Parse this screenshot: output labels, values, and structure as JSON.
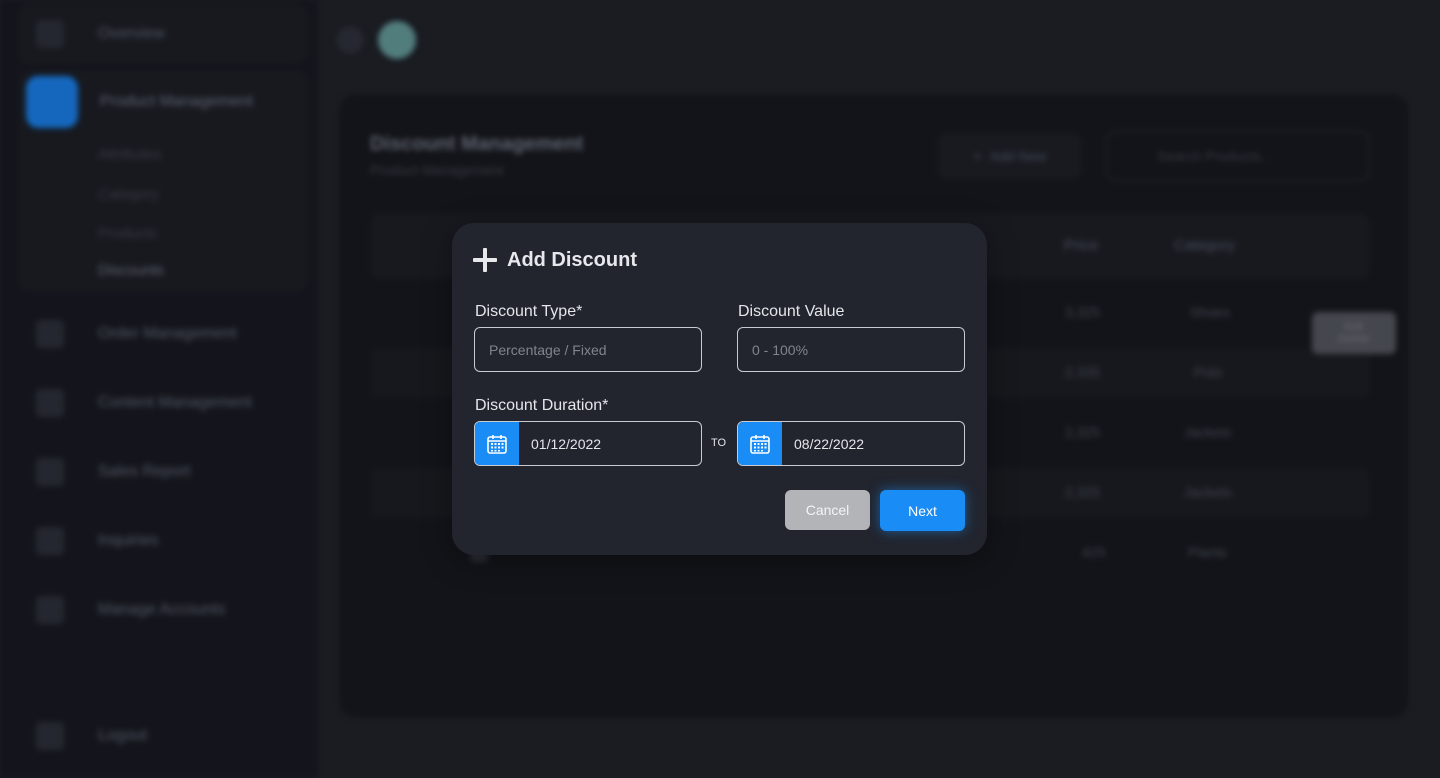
{
  "sidebar": {
    "overview": "Overview",
    "product_management": "Product Management",
    "sub_items": [
      "Attributes",
      "Category",
      "Products",
      "Discounts"
    ],
    "items": [
      "Order Management",
      "Content Management",
      "Sales Report",
      "Inquiries",
      "Manage Accounts"
    ],
    "logout": "Logout"
  },
  "panel": {
    "title": "Discount Management",
    "subtitle": "Product Management",
    "add_new_label": "Add New",
    "search_placeholder": "Search Products...",
    "columns": [
      "Price",
      "Category"
    ],
    "rows": [
      {
        "price": "3,325",
        "category": "Shoes"
      },
      {
        "price": "2,335",
        "category": "Pots"
      },
      {
        "price": "2,325",
        "category": "Jackets"
      },
      {
        "price": "2,325",
        "category": "Jackets"
      },
      {
        "price": "425",
        "category": "Plants"
      }
    ],
    "tooltip": [
      "Edit",
      "Delete"
    ]
  },
  "modal": {
    "title": "Add Discount",
    "discount_type_label": "Discount Type*",
    "discount_type_placeholder": "Percentage / Fixed",
    "discount_value_label": "Discount Value",
    "discount_value_placeholder": "0 - 100%",
    "duration_label": "Discount Duration*",
    "start_date": "01/12/2022",
    "to_label": "TO",
    "end_date": "08/22/2022",
    "cancel_label": "Cancel",
    "next_label": "Next"
  },
  "colors": {
    "accent": "#1a8cf5",
    "modal_bg": "#22252e",
    "page_bg": "#1e2027"
  },
  "icons": [
    "plus-icon",
    "calendar-icon"
  ]
}
